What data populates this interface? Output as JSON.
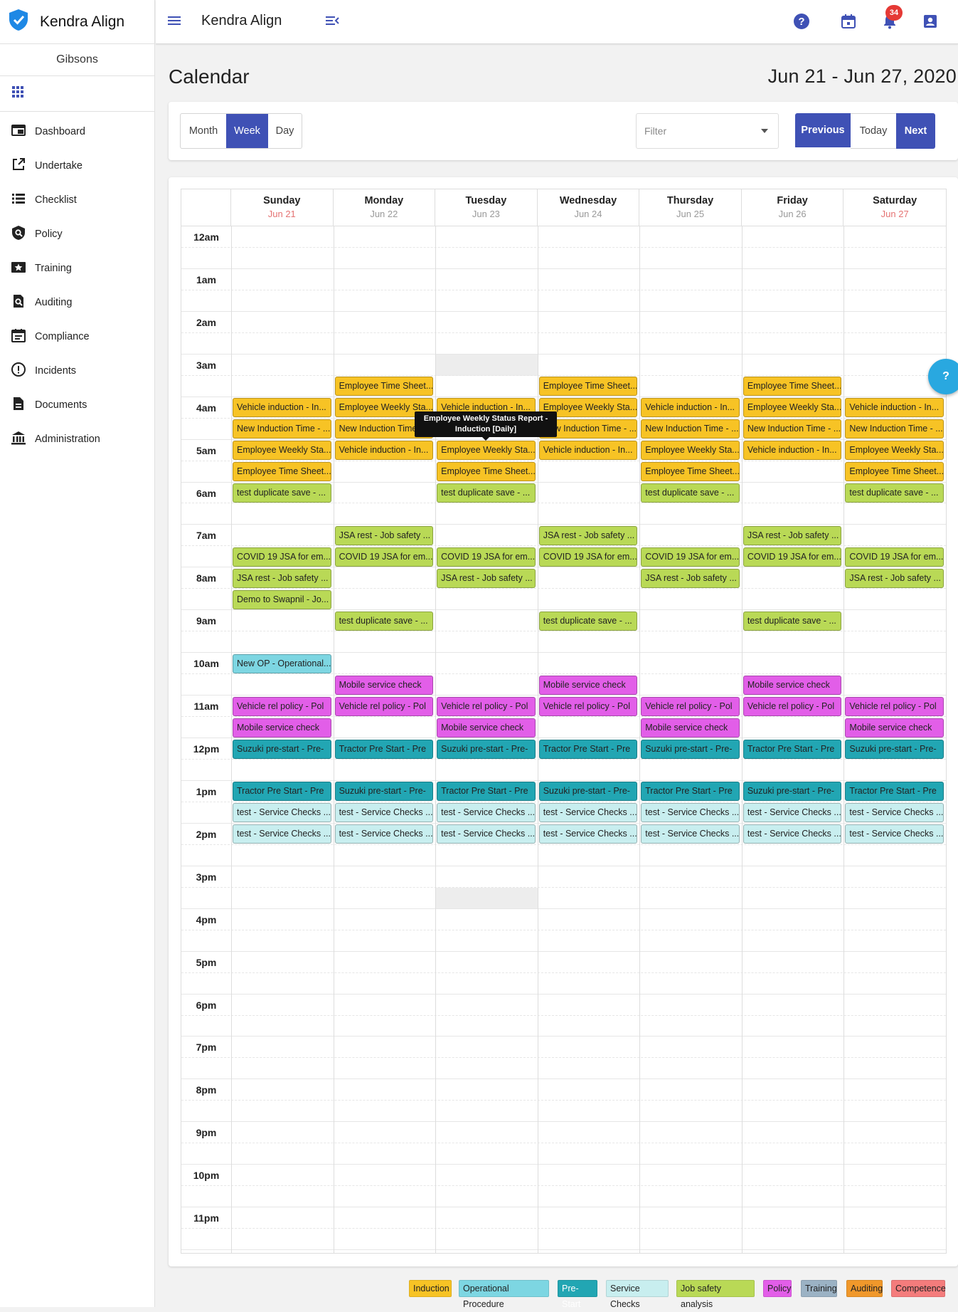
{
  "app": {
    "name": "Kendra Align",
    "org": "Gibsons",
    "notifications": "34"
  },
  "nav": [
    {
      "label": "Dashboard",
      "icon": "dashboard-icon"
    },
    {
      "label": "Undertake",
      "icon": "open-in-new-icon"
    },
    {
      "label": "Checklist",
      "icon": "checklist-icon"
    },
    {
      "label": "Policy",
      "icon": "policy-icon"
    },
    {
      "label": "Training",
      "icon": "training-icon"
    },
    {
      "label": "Auditing",
      "icon": "auditing-icon"
    },
    {
      "label": "Compliance",
      "icon": "compliance-icon"
    },
    {
      "label": "Incidents",
      "icon": "incidents-icon"
    },
    {
      "label": "Documents",
      "icon": "documents-icon"
    },
    {
      "label": "Administration",
      "icon": "administration-icon"
    }
  ],
  "page": {
    "title": "Calendar",
    "range": "Jun 21 - Jun 27, 2020"
  },
  "views": {
    "month": "Month",
    "week": "Week",
    "day": "Day",
    "active": "Week"
  },
  "filter": {
    "placeholder": "Filter"
  },
  "navbtns": {
    "previous": "Previous",
    "today": "Today",
    "next": "Next"
  },
  "days": [
    {
      "name": "Sunday",
      "date": "Jun 21",
      "weekend": true
    },
    {
      "name": "Monday",
      "date": "Jun 22",
      "weekend": false
    },
    {
      "name": "Tuesday",
      "date": "Jun 23",
      "weekend": false
    },
    {
      "name": "Wednesday",
      "date": "Jun 24",
      "weekend": false
    },
    {
      "name": "Thursday",
      "date": "Jun 25",
      "weekend": false
    },
    {
      "name": "Friday",
      "date": "Jun 26",
      "weekend": false
    },
    {
      "name": "Saturday",
      "date": "Jun 27",
      "weekend": true
    }
  ],
  "hours": [
    "12am",
    "1am",
    "2am",
    "3am",
    "4am",
    "5am",
    "6am",
    "7am",
    "8am",
    "9am",
    "10am",
    "11am",
    "12pm",
    "1pm",
    "2pm",
    "3pm",
    "4pm",
    "5pm",
    "6pm",
    "7pm",
    "8pm",
    "9pm",
    "10pm",
    "11pm"
  ],
  "categories": {
    "induction": {
      "label": "Induction",
      "color": "#f7c325"
    },
    "operational": {
      "label": "Operational Procedure",
      "color": "#7dd6e2"
    },
    "prestart": {
      "label": "Pre-Start",
      "color": "#22a6b3"
    },
    "service": {
      "label": "Service Checks",
      "color": "#c8eeef"
    },
    "jsa": {
      "label": "Job safety analysis",
      "color": "#b9d956"
    },
    "policy": {
      "label": "Policy",
      "color": "#e25ee8"
    },
    "training": {
      "label": "Training",
      "color": "#9bb2c4"
    },
    "auditing": {
      "label": "Auditing",
      "color": "#f0982b"
    },
    "competence": {
      "label": "Competence",
      "color": "#f47c7c"
    }
  },
  "events": [
    {
      "day": 1,
      "slot": 7,
      "cat": "induction",
      "title": "Employee Time Sheet..."
    },
    {
      "day": 3,
      "slot": 7,
      "cat": "induction",
      "title": "Employee Time Sheet..."
    },
    {
      "day": 5,
      "slot": 7,
      "cat": "induction",
      "title": "Employee Time Sheet..."
    },
    {
      "day": 0,
      "slot": 8,
      "cat": "induction",
      "title": "Vehicle induction - In..."
    },
    {
      "day": 1,
      "slot": 8,
      "cat": "induction",
      "title": "Employee Weekly Sta..."
    },
    {
      "day": 2,
      "slot": 8,
      "cat": "induction",
      "title": "Vehicle induction - In..."
    },
    {
      "day": 3,
      "slot": 8,
      "cat": "induction",
      "title": "Employee Weekly Sta..."
    },
    {
      "day": 4,
      "slot": 8,
      "cat": "induction",
      "title": "Vehicle induction - In..."
    },
    {
      "day": 5,
      "slot": 8,
      "cat": "induction",
      "title": "Employee Weekly Sta..."
    },
    {
      "day": 6,
      "slot": 8,
      "cat": "induction",
      "title": "Vehicle induction - In..."
    },
    {
      "day": 0,
      "slot": 9,
      "cat": "induction",
      "title": "New Induction Time - ..."
    },
    {
      "day": 1,
      "slot": 9,
      "cat": "induction",
      "title": "New Induction Time - ..."
    },
    {
      "day": 3,
      "slot": 9,
      "cat": "induction",
      "title": "New Induction Time - ..."
    },
    {
      "day": 4,
      "slot": 9,
      "cat": "induction",
      "title": "New Induction Time - ..."
    },
    {
      "day": 5,
      "slot": 9,
      "cat": "induction",
      "title": "New Induction Time - ..."
    },
    {
      "day": 6,
      "slot": 9,
      "cat": "induction",
      "title": "New Induction Time - ..."
    },
    {
      "day": 0,
      "slot": 10,
      "cat": "induction",
      "title": "Employee Weekly Sta..."
    },
    {
      "day": 1,
      "slot": 10,
      "cat": "induction",
      "title": "Vehicle induction - In..."
    },
    {
      "day": 2,
      "slot": 10,
      "cat": "induction",
      "title": "Employee Weekly Sta..."
    },
    {
      "day": 3,
      "slot": 10,
      "cat": "induction",
      "title": "Vehicle induction - In..."
    },
    {
      "day": 4,
      "slot": 10,
      "cat": "induction",
      "title": "Employee Weekly Sta..."
    },
    {
      "day": 5,
      "slot": 10,
      "cat": "induction",
      "title": "Vehicle induction - In..."
    },
    {
      "day": 6,
      "slot": 10,
      "cat": "induction",
      "title": "Employee Weekly Sta..."
    },
    {
      "day": 0,
      "slot": 11,
      "cat": "induction",
      "title": "Employee Time Sheet..."
    },
    {
      "day": 2,
      "slot": 11,
      "cat": "induction",
      "title": "Employee Time Sheet..."
    },
    {
      "day": 4,
      "slot": 11,
      "cat": "induction",
      "title": "Employee Time Sheet..."
    },
    {
      "day": 6,
      "slot": 11,
      "cat": "induction",
      "title": "Employee Time Sheet..."
    },
    {
      "day": 0,
      "slot": 12,
      "cat": "jsa",
      "title": "test duplicate save - ..."
    },
    {
      "day": 2,
      "slot": 12,
      "cat": "jsa",
      "title": "test duplicate save - ..."
    },
    {
      "day": 4,
      "slot": 12,
      "cat": "jsa",
      "title": "test duplicate save - ..."
    },
    {
      "day": 6,
      "slot": 12,
      "cat": "jsa",
      "title": "test duplicate save - ..."
    },
    {
      "day": 1,
      "slot": 14,
      "cat": "jsa",
      "title": "JSA rest - Job safety ..."
    },
    {
      "day": 3,
      "slot": 14,
      "cat": "jsa",
      "title": "JSA rest - Job safety ..."
    },
    {
      "day": 5,
      "slot": 14,
      "cat": "jsa",
      "title": "JSA rest - Job safety ..."
    },
    {
      "day": 0,
      "slot": 15,
      "cat": "jsa",
      "title": "COVID 19 JSA for em..."
    },
    {
      "day": 1,
      "slot": 15,
      "cat": "jsa",
      "title": "COVID 19 JSA for em..."
    },
    {
      "day": 2,
      "slot": 15,
      "cat": "jsa",
      "title": "COVID 19 JSA for em..."
    },
    {
      "day": 3,
      "slot": 15,
      "cat": "jsa",
      "title": "COVID 19 JSA for em..."
    },
    {
      "day": 4,
      "slot": 15,
      "cat": "jsa",
      "title": "COVID 19 JSA for em..."
    },
    {
      "day": 5,
      "slot": 15,
      "cat": "jsa",
      "title": "COVID 19 JSA for em..."
    },
    {
      "day": 6,
      "slot": 15,
      "cat": "jsa",
      "title": "COVID 19 JSA for em..."
    },
    {
      "day": 0,
      "slot": 16,
      "cat": "jsa",
      "title": "JSA rest - Job safety ..."
    },
    {
      "day": 2,
      "slot": 16,
      "cat": "jsa",
      "title": "JSA rest - Job safety ..."
    },
    {
      "day": 4,
      "slot": 16,
      "cat": "jsa",
      "title": "JSA rest - Job safety ..."
    },
    {
      "day": 6,
      "slot": 16,
      "cat": "jsa",
      "title": "JSA rest - Job safety ..."
    },
    {
      "day": 0,
      "slot": 17,
      "cat": "jsa",
      "title": "Demo to Swapnil - Jo..."
    },
    {
      "day": 1,
      "slot": 18,
      "cat": "jsa",
      "title": "test duplicate save - ..."
    },
    {
      "day": 3,
      "slot": 18,
      "cat": "jsa",
      "title": "test duplicate save - ..."
    },
    {
      "day": 5,
      "slot": 18,
      "cat": "jsa",
      "title": "test duplicate save - ..."
    },
    {
      "day": 0,
      "slot": 20,
      "cat": "operational",
      "title": "New OP - Operational..."
    },
    {
      "day": 1,
      "slot": 21,
      "cat": "policy",
      "title": "Mobile service check"
    },
    {
      "day": 3,
      "slot": 21,
      "cat": "policy",
      "title": "Mobile service check"
    },
    {
      "day": 5,
      "slot": 21,
      "cat": "policy",
      "title": "Mobile service check"
    },
    {
      "day": 0,
      "slot": 22,
      "cat": "policy",
      "title": "Vehicle rel policy - Pol"
    },
    {
      "day": 1,
      "slot": 22,
      "cat": "policy",
      "title": "Vehicle rel policy - Pol"
    },
    {
      "day": 2,
      "slot": 22,
      "cat": "policy",
      "title": "Vehicle rel policy - Pol"
    },
    {
      "day": 3,
      "slot": 22,
      "cat": "policy",
      "title": "Vehicle rel policy - Pol"
    },
    {
      "day": 4,
      "slot": 22,
      "cat": "policy",
      "title": "Vehicle rel policy - Pol"
    },
    {
      "day": 5,
      "slot": 22,
      "cat": "policy",
      "title": "Vehicle rel policy - Pol"
    },
    {
      "day": 6,
      "slot": 22,
      "cat": "policy",
      "title": "Vehicle rel policy - Pol"
    },
    {
      "day": 0,
      "slot": 23,
      "cat": "policy",
      "title": "Mobile service check"
    },
    {
      "day": 2,
      "slot": 23,
      "cat": "policy",
      "title": "Mobile service check"
    },
    {
      "day": 4,
      "slot": 23,
      "cat": "policy",
      "title": "Mobile service check"
    },
    {
      "day": 6,
      "slot": 23,
      "cat": "policy",
      "title": "Mobile service check"
    },
    {
      "day": 0,
      "slot": 24,
      "cat": "prestart",
      "title": "Suzuki pre-start - Pre-"
    },
    {
      "day": 1,
      "slot": 24,
      "cat": "prestart",
      "title": "Tractor Pre Start - Pre"
    },
    {
      "day": 2,
      "slot": 24,
      "cat": "prestart",
      "title": "Suzuki pre-start - Pre-"
    },
    {
      "day": 3,
      "slot": 24,
      "cat": "prestart",
      "title": "Tractor Pre Start - Pre"
    },
    {
      "day": 4,
      "slot": 24,
      "cat": "prestart",
      "title": "Suzuki pre-start - Pre-"
    },
    {
      "day": 5,
      "slot": 24,
      "cat": "prestart",
      "title": "Tractor Pre Start - Pre"
    },
    {
      "day": 6,
      "slot": 24,
      "cat": "prestart",
      "title": "Suzuki pre-start - Pre-"
    },
    {
      "day": 0,
      "slot": 26,
      "cat": "prestart",
      "title": "Tractor Pre Start - Pre"
    },
    {
      "day": 1,
      "slot": 26,
      "cat": "prestart",
      "title": "Suzuki pre-start - Pre-"
    },
    {
      "day": 2,
      "slot": 26,
      "cat": "prestart",
      "title": "Tractor Pre Start - Pre"
    },
    {
      "day": 3,
      "slot": 26,
      "cat": "prestart",
      "title": "Suzuki pre-start - Pre-"
    },
    {
      "day": 4,
      "slot": 26,
      "cat": "prestart",
      "title": "Tractor Pre Start - Pre"
    },
    {
      "day": 5,
      "slot": 26,
      "cat": "prestart",
      "title": "Suzuki pre-start - Pre-"
    },
    {
      "day": 6,
      "slot": 26,
      "cat": "prestart",
      "title": "Tractor Pre Start - Pre"
    },
    {
      "day": 0,
      "slot": 27,
      "cat": "service",
      "title": "test - Service Checks ..."
    },
    {
      "day": 1,
      "slot": 27,
      "cat": "service",
      "title": "test - Service Checks ..."
    },
    {
      "day": 2,
      "slot": 27,
      "cat": "service",
      "title": "test - Service Checks ..."
    },
    {
      "day": 3,
      "slot": 27,
      "cat": "service",
      "title": "test - Service Checks ..."
    },
    {
      "day": 4,
      "slot": 27,
      "cat": "service",
      "title": "test - Service Checks ..."
    },
    {
      "day": 5,
      "slot": 27,
      "cat": "service",
      "title": "test - Service Checks ..."
    },
    {
      "day": 6,
      "slot": 27,
      "cat": "service",
      "title": "test - Service Checks ..."
    },
    {
      "day": 0,
      "slot": 28,
      "cat": "service",
      "title": "test - Service Checks ..."
    },
    {
      "day": 1,
      "slot": 28,
      "cat": "service",
      "title": "test - Service Checks ..."
    },
    {
      "day": 2,
      "slot": 28,
      "cat": "service",
      "title": "test - Service Checks ..."
    },
    {
      "day": 3,
      "slot": 28,
      "cat": "service",
      "title": "test - Service Checks ..."
    },
    {
      "day": 4,
      "slot": 28,
      "cat": "service",
      "title": "test - Service Checks ..."
    },
    {
      "day": 5,
      "slot": 28,
      "cat": "service",
      "title": "test - Service Checks ..."
    },
    {
      "day": 6,
      "slot": 28,
      "cat": "service",
      "title": "test - Service Checks ..."
    }
  ],
  "tooltip": {
    "line1": "Employee Weekly Status Report -",
    "line2": "Induction [Daily]"
  },
  "help": "?"
}
